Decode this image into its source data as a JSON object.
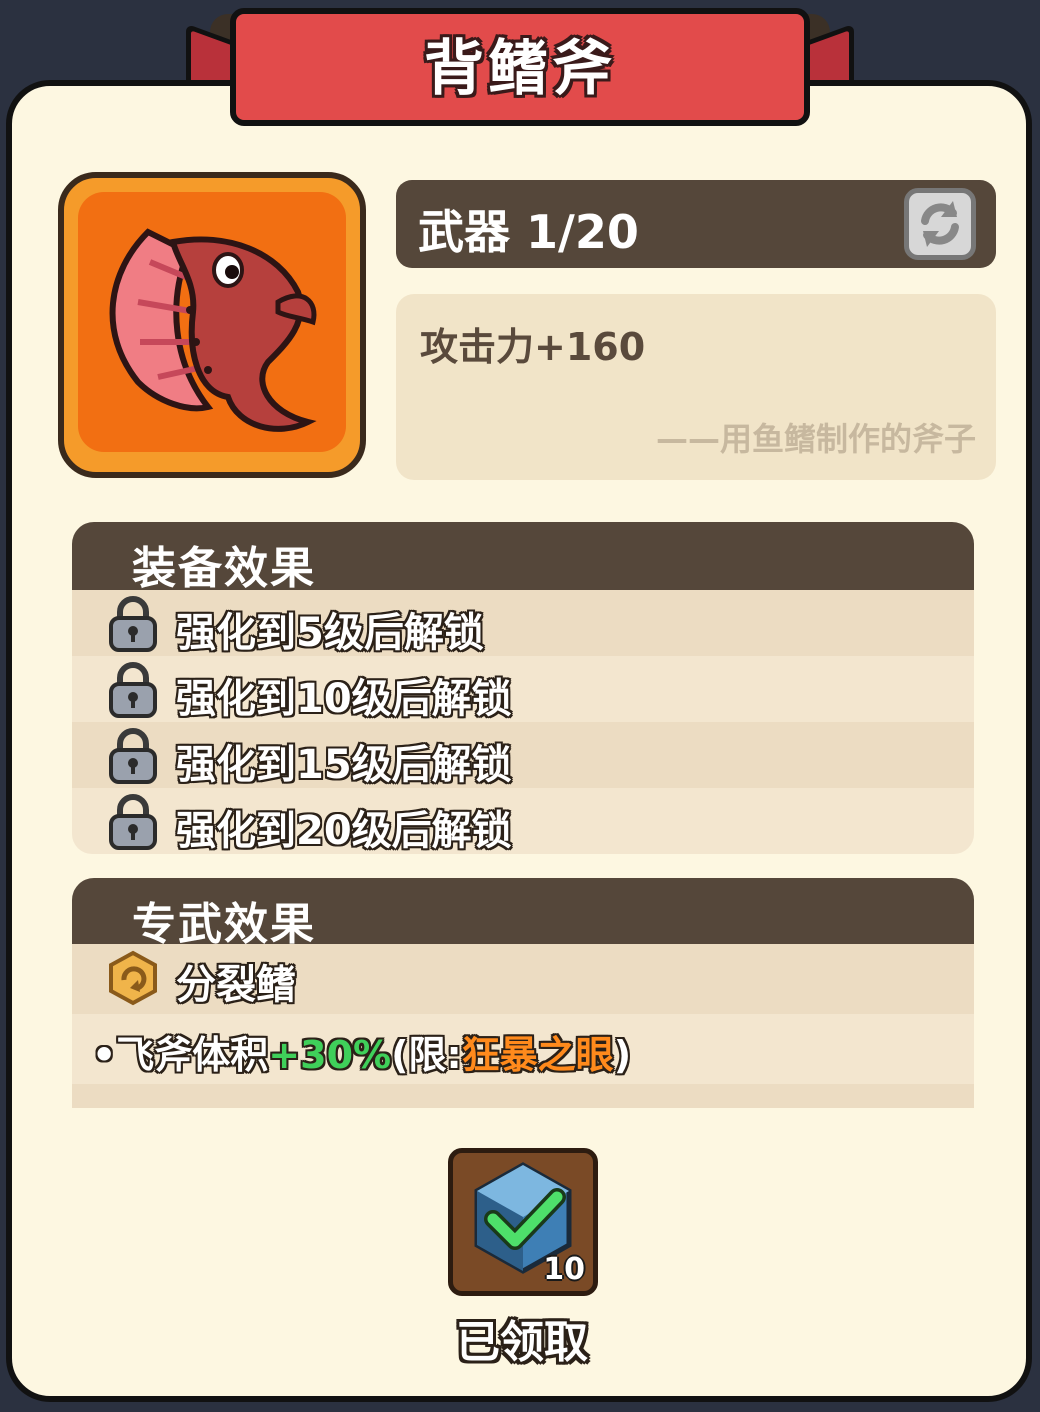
{
  "title": "背鳍斧",
  "weapon": {
    "label": "武器 1/20",
    "refresh_icon": "refresh-icon"
  },
  "description": {
    "stat": "攻击力+160",
    "quote": "——用鱼鳍制作的斧子"
  },
  "equip_effects": {
    "heading": "装备效果",
    "items": [
      {
        "text": "强化到5级后解锁",
        "icon": "lock-icon"
      },
      {
        "text": "强化到10级后解锁",
        "icon": "lock-icon"
      },
      {
        "text": "强化到15级后解锁",
        "icon": "lock-icon"
      },
      {
        "text": "强化到20级后解锁",
        "icon": "lock-icon"
      }
    ]
  },
  "exclusive_effects": {
    "heading": "专武效果",
    "skill_name": "分裂鳍",
    "line": {
      "prefix": "•飞斧体积",
      "bonus": "+30%",
      "limit_open": "(限:",
      "limit_target": "狂暴之眼",
      "limit_close": ")"
    }
  },
  "reward": {
    "count": "10",
    "status": "已领取"
  },
  "colors": {
    "banner": "#e24b4b",
    "header_bar": "#55473a",
    "icon_bg": "#f26f12",
    "bonus_green": "#3fd05a",
    "limit_orange": "#ff8a1c"
  }
}
